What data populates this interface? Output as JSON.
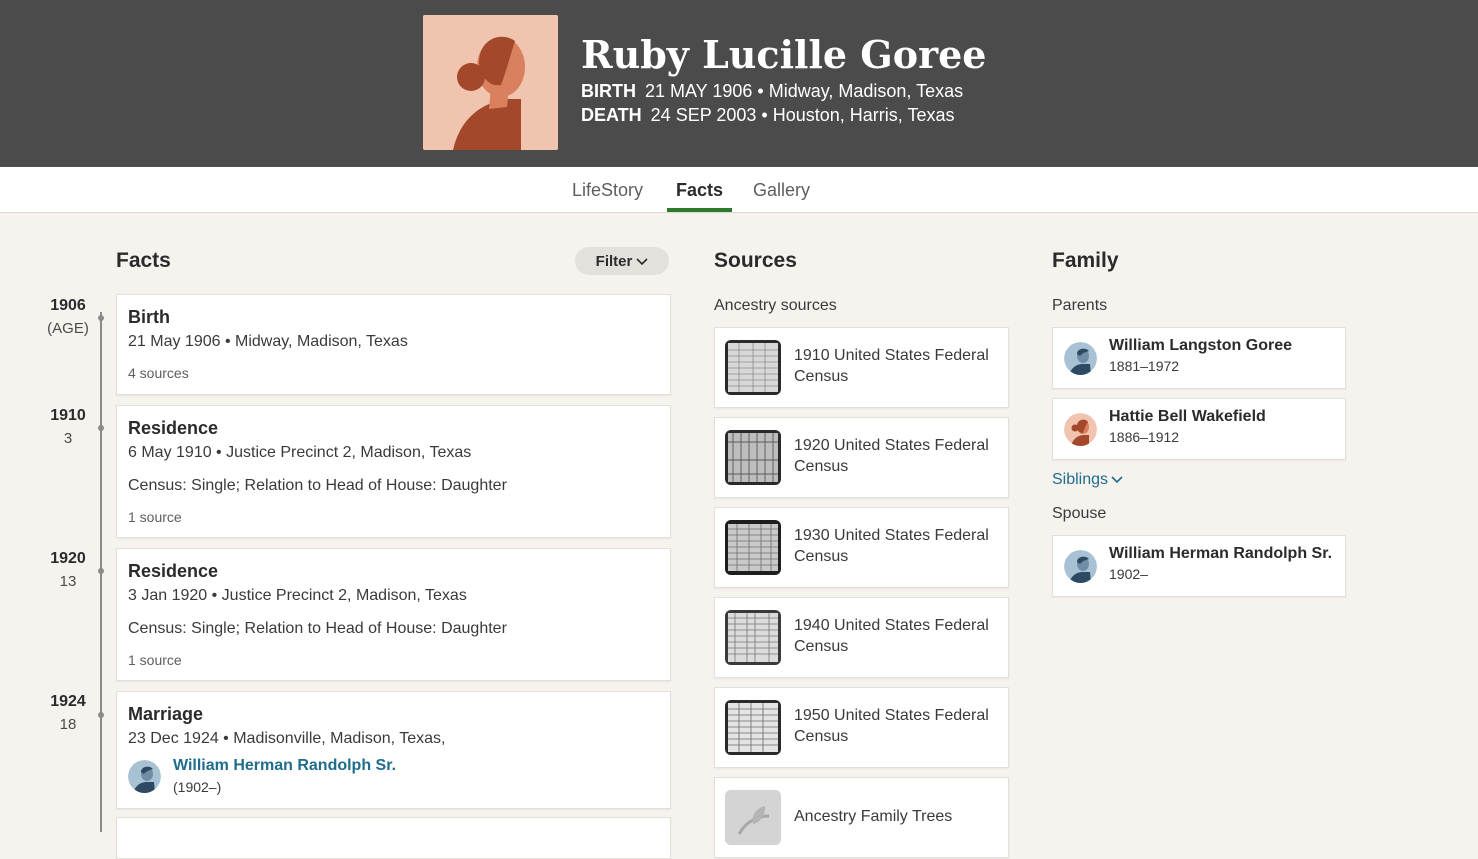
{
  "person": {
    "name": "Ruby Lucille Goree",
    "birth_label": "BIRTH",
    "birth_value": "21 MAY 1906 • Midway, Madison, Texas",
    "death_label": "DEATH",
    "death_value": "24 SEP 2003 • Houston, Harris, Texas"
  },
  "tabs": [
    {
      "label": "LifeStory"
    },
    {
      "label": "Facts",
      "active": true
    },
    {
      "label": "Gallery"
    }
  ],
  "facts": {
    "title": "Facts",
    "filter_label": "Filter",
    "timeline": [
      {
        "year": "1906",
        "age": "(AGE)"
      },
      {
        "year": "1910",
        "age": "3"
      },
      {
        "year": "1920",
        "age": "13"
      },
      {
        "year": "1924",
        "age": "18"
      }
    ],
    "items": [
      {
        "title": "Birth",
        "detail": "21 May 1906 • Midway, Madison, Texas",
        "sources": "4 sources"
      },
      {
        "title": "Residence",
        "detail": "6 May 1910 • Justice Precinct 2, Madison, Texas",
        "note": "Census: Single; Relation to Head of House: Daughter",
        "sources": "1 source"
      },
      {
        "title": "Residence",
        "detail": "3 Jan 1920 • Justice Precinct 2, Madison, Texas",
        "note": "Census: Single; Relation to Head of House: Daughter",
        "sources": "1 source"
      },
      {
        "title": "Marriage",
        "detail": "23 Dec 1924 • Madisonville, Madison, Texas,",
        "spouse_name": "William Herman Randolph Sr.",
        "spouse_years": "(1902–)"
      }
    ]
  },
  "sources": {
    "title": "Sources",
    "subtitle": "Ancestry sources",
    "items": [
      {
        "name": "1910 United States Federal Census"
      },
      {
        "name": "1920 United States Federal Census"
      },
      {
        "name": "1930 United States Federal Census"
      },
      {
        "name": "1940 United States Federal Census"
      },
      {
        "name": "1950 United States Federal Census"
      },
      {
        "name": "Ancestry Family Trees"
      }
    ]
  },
  "family": {
    "title": "Family",
    "parents_label": "Parents",
    "parents": [
      {
        "name": "William Langston Goree",
        "years": "1881–1972",
        "gender": "male"
      },
      {
        "name": "Hattie Bell Wakefield",
        "years": "1886–1912",
        "gender": "female"
      }
    ],
    "siblings_label": "Siblings",
    "spouse_label": "Spouse",
    "spouse": {
      "name": "William Herman Randolph Sr.",
      "years": "1902–",
      "gender": "male"
    }
  },
  "colors": {
    "header_bg": "#4b4b4b",
    "accent_green": "#2f7a2a",
    "link_blue": "#1f6c8c",
    "page_bg": "#f6f3ef"
  },
  "icons": {
    "portrait": "female-silhouette-icon",
    "filter_chevron": "chevron-down-icon",
    "siblings_chevron": "chevron-down-icon",
    "male_avatar": "male-avatar-icon",
    "female_avatar": "female-avatar-icon",
    "census_thumb": "census-document-icon",
    "tree_thumb": "family-tree-leaf-icon"
  }
}
